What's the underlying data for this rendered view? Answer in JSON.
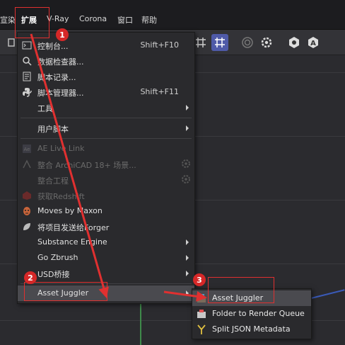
{
  "menubar": {
    "items": [
      {
        "label": "宣染"
      },
      {
        "label": "扩展"
      },
      {
        "label": "V-Ray"
      },
      {
        "label": "Corona"
      },
      {
        "label": "窗口"
      },
      {
        "label": "帮助"
      }
    ]
  },
  "menu": {
    "items": [
      {
        "label": "控制台...",
        "shortcut": "Shift+F10",
        "icon": "console-icon"
      },
      {
        "label": "数据检查器...",
        "icon": "inspector-icon"
      },
      {
        "label": "脚本记录...",
        "icon": "script-log-icon"
      },
      {
        "label": "脚本管理器...",
        "shortcut": "Shift+F11",
        "icon": "python-icon"
      },
      {
        "label": "工具",
        "submenu": true
      },
      {
        "label": "用户脚本",
        "submenu": true
      },
      {
        "label": "AE Live Link",
        "disabled": true,
        "icon": "ae-icon"
      },
      {
        "label": "整合 ArchiCAD 18+ 场景...",
        "disabled": true,
        "icon": "archicad-icon"
      },
      {
        "label": "整合工程",
        "disabled": true
      },
      {
        "label": "获取Redshift",
        "disabled": true,
        "icon": "redshift-icon"
      },
      {
        "label": "Moves by Maxon",
        "icon": "moves-icon"
      },
      {
        "label": "将项目发送给Forger",
        "icon": "forger-icon"
      },
      {
        "label": "Substance Engine",
        "submenu": true
      },
      {
        "label": "Go Zbrush",
        "submenu": true
      },
      {
        "label": "USD桥接",
        "submenu": true
      },
      {
        "label": "Asset Juggler",
        "submenu": true
      }
    ]
  },
  "submenu": {
    "items": [
      {
        "label": "Asset Juggler",
        "icon": "asset-juggler-icon"
      },
      {
        "label": "Folder to Render Queue",
        "icon": "render-queue-icon"
      },
      {
        "label": "Split JSON Metadata",
        "icon": "split-icon"
      }
    ]
  },
  "annotations": {
    "badges": [
      "1",
      "2",
      "3"
    ]
  },
  "colors": {
    "highlight": "#4a4a4f",
    "annotation_red": "#e03030",
    "badge_red": "#d62828"
  }
}
